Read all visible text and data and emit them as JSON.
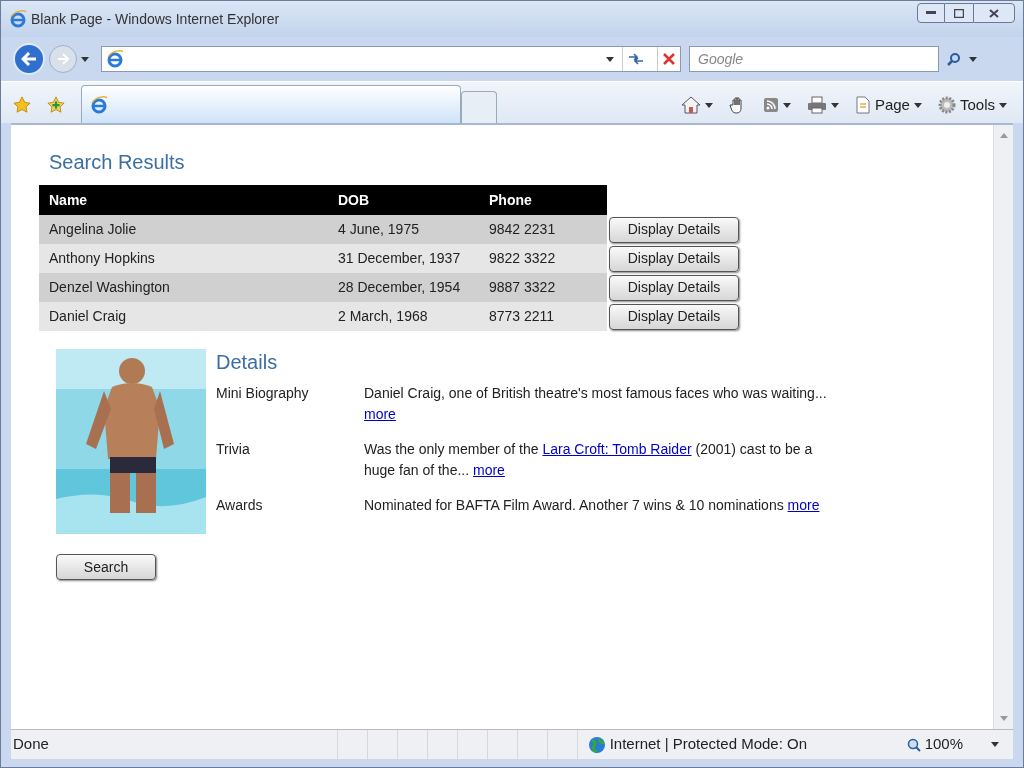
{
  "window": {
    "title": "Blank Page - Windows Internet Explorer"
  },
  "search_box": {
    "placeholder": "Google"
  },
  "command_bar": [
    {
      "kind": "home"
    },
    {
      "kind": "hand"
    },
    {
      "kind": "feed"
    },
    {
      "kind": "print"
    },
    {
      "kind": "page",
      "label": "Page"
    },
    {
      "kind": "tools",
      "label": "Tools"
    }
  ],
  "content": {
    "title": "Search Results",
    "table": {
      "columns": [
        "Name",
        "DOB",
        "Phone"
      ],
      "rows": [
        {
          "cells": [
            "Angelina Jolie",
            "4 June, 1975",
            "9842 2231"
          ],
          "action": "Display Details"
        },
        {
          "cells": [
            "Anthony Hopkins",
            "31 December, 1937",
            "9822 3322"
          ],
          "action": "Display Details"
        },
        {
          "cells": [
            "Denzel Washington",
            "28 December, 1954",
            "9887 3322"
          ],
          "action": "Display Details"
        },
        {
          "cells": [
            "Daniel Craig",
            "2 March, 1968",
            "8773 2211"
          ],
          "action": "Display Details"
        }
      ]
    },
    "details": {
      "title": "Details",
      "items": [
        {
          "label": "Mini Biography",
          "segments": [
            {
              "kind": "text",
              "text": "Daniel Craig, one of British theatre's most famous faces who was waiting... "
            },
            {
              "kind": "link",
              "text": "more"
            }
          ]
        },
        {
          "label": "Trivia",
          "segments": [
            {
              "kind": "text",
              "text": "Was the only member of the "
            },
            {
              "kind": "link",
              "text": "Lara Croft: Tomb Raider"
            },
            {
              "kind": "text",
              "text": " (2001) cast to be a huge fan of the... "
            },
            {
              "kind": "link",
              "text": "more"
            }
          ]
        },
        {
          "label": "Awards",
          "segments": [
            {
              "kind": "text",
              "text": "Nominated for BAFTA Film Award. Another 7 wins & 10 nominations "
            },
            {
              "kind": "link",
              "text": "more"
            }
          ]
        }
      ]
    },
    "search_button": "Search"
  },
  "status_bar": {
    "status": "Done",
    "zone": "Internet | Protected Mode: On",
    "zoom": "100%"
  }
}
